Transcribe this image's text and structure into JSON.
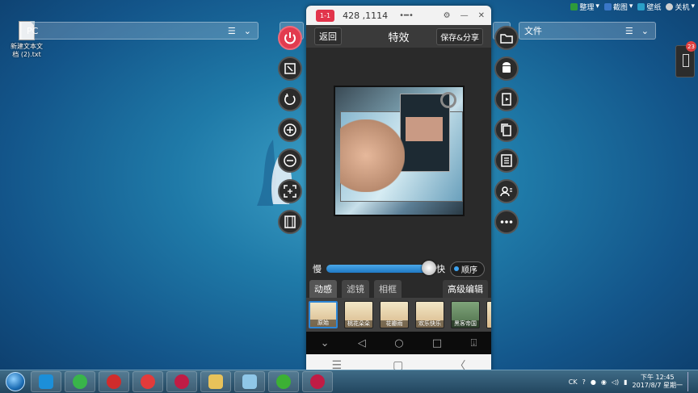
{
  "tray_top": [
    {
      "label": "整理",
      "color": "#2e9a3a"
    },
    {
      "label": "截图",
      "color": "#3a77c8"
    },
    {
      "label": "壁纸",
      "color": "#2aa0c8"
    },
    {
      "label": "关机",
      "color": "#d0d0d0"
    }
  ],
  "desktop_file": {
    "name": "新建文本文档 (2).txt"
  },
  "address_left": {
    "text": "PC"
  },
  "address_right": {
    "text": "文件"
  },
  "emulator": {
    "badge": "1-1",
    "coords": "428 ,1114",
    "app": {
      "back": "返回",
      "title": "特效",
      "share": "保存&分享"
    },
    "speed": {
      "slow": "慢",
      "fast": "快",
      "order": "顺序"
    },
    "tabs": [
      "动感",
      "滤镜",
      "相框"
    ],
    "advanced": "高级编辑",
    "thumbs": [
      "原始",
      "桃花朵朵",
      "花瓣雨",
      "欢乐快乐",
      "黑客帝国",
      ""
    ]
  },
  "notification": {
    "count": "23"
  },
  "taskbar": {
    "ime": "CK",
    "time": "下午 12:45",
    "date": "2017/8/7 星期一"
  },
  "colors": {
    "accent": "#2d86d6",
    "badge": "#e2344b"
  }
}
